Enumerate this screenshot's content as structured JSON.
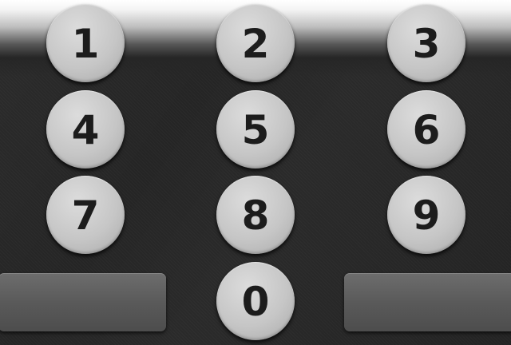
{
  "keypad": {
    "keys": {
      "k1": "1",
      "k2": "2",
      "k3": "3",
      "k4": "4",
      "k5": "5",
      "k6": "6",
      "k7": "7",
      "k8": "8",
      "k9": "9",
      "k0": "0"
    },
    "left_action_label": "",
    "right_action_label": ""
  },
  "colors": {
    "key_face": "#c6c6c6",
    "key_text": "#1c1c1c",
    "background": "#262626",
    "side_key": "#5a5a5a"
  }
}
